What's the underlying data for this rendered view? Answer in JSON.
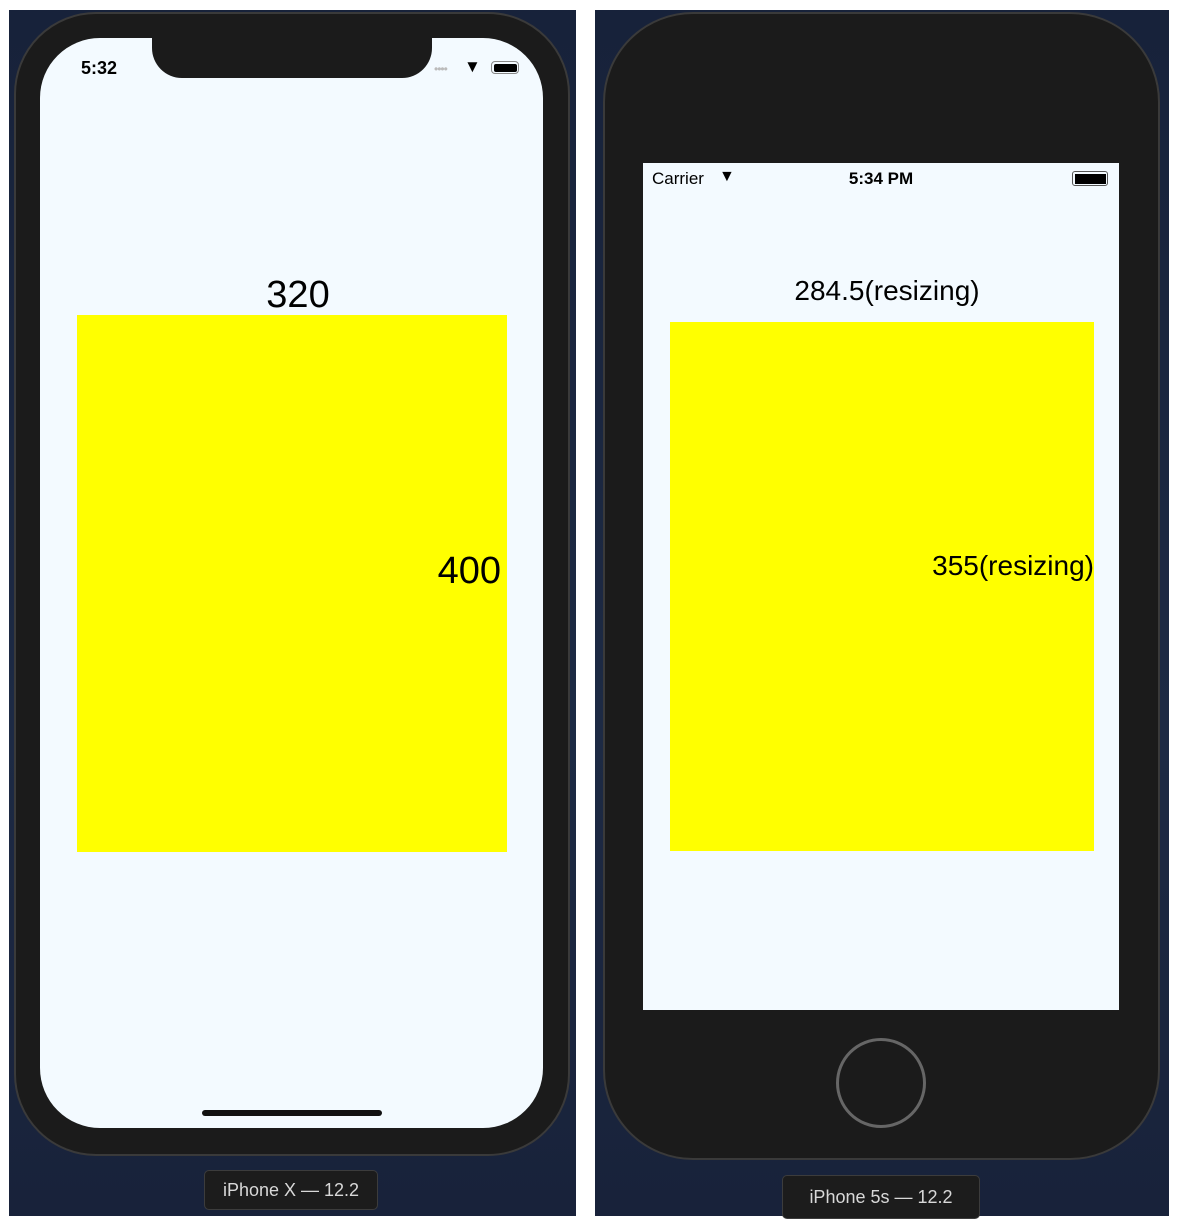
{
  "left_device": {
    "name": "iPhone X — 12.2",
    "status_time": "5:32",
    "width_label": "320",
    "height_label": "400",
    "box_color": "#ffff00"
  },
  "right_device": {
    "name": "iPhone 5s — 12.2",
    "carrier": "Carrier",
    "status_time": "5:34 PM",
    "width_label": "284.5(resizing)",
    "height_label": "355(resizing)",
    "box_color": "#ffff00"
  }
}
